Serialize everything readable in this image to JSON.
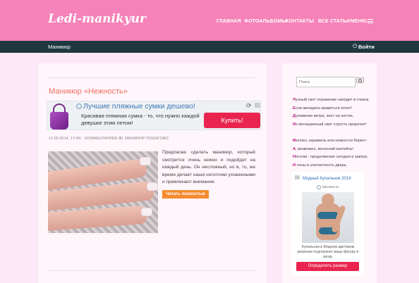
{
  "header": {
    "logo": "Ledi-manikyur",
    "nav": [
      "ГЛАВНАЯ",
      "ФОТОАЛЬБОМЫ",
      "КОНТАКТЫ",
      "ВСЕ СТАТЬИ",
      "МЕНЮ"
    ]
  },
  "subbar": {
    "breadcrumb": "Маникюр",
    "login_label": "Войти"
  },
  "post": {
    "title": "Маникюр «Нежность»",
    "date": "11-06-2014, 17:49",
    "comments": "КОММЕНТАРИЕВ (0)",
    "category": "МАНИКЮР ПОШАГОВО",
    "excerpt": "Предлагаю сделать маникюр, который смотрится очень нежно и подойдет на каждый день. Он несложный, но в, то, же время делает наши ноготочки ухоженными и привлекают внимание.",
    "read_more": "Читать полностью"
  },
  "ad_top": {
    "title": "Лучшие пляжные сумки дешево!",
    "text": "Красивая пляжная сумка - то, что нужно каждой девушке этим летом!",
    "button": "Купить!"
  },
  "sidebar": {
    "search_placeholder": "Поиск",
    "poem1": [
      {
        "cap": "Л",
        "rest": "унный свет отражение находит в глазок,"
      },
      {
        "cap": "Е",
        "rest": "сли женщина нравиться хочет!"
      },
      {
        "cap": "Д",
        "rest": "уновение ветра, зонт на ногтях,"
      },
      {
        "cap": "И",
        "rest": "х мосацкинный свет стрость пророчит!"
      }
    ],
    "poem2": [
      {
        "cap": "М",
        "rest": "олоко, карамель или нежности беркот -"
      },
      {
        "cap": "А",
        "rest": ", возможно, весенний коктейль!"
      },
      {
        "cap": "Н",
        "rest": "оготки - продолжение сегодня и завтра,"
      },
      {
        "cap": "И",
        "rest": " очны в элегантность дверь."
      }
    ],
    "ad": {
      "title": "Модный Купальник 2014",
      "domain": "lascana.ru",
      "desc": "Купальник в Модном цветовом решении подчеркнет вашу фигуру и загар.",
      "button": "Определить размер"
    }
  }
}
